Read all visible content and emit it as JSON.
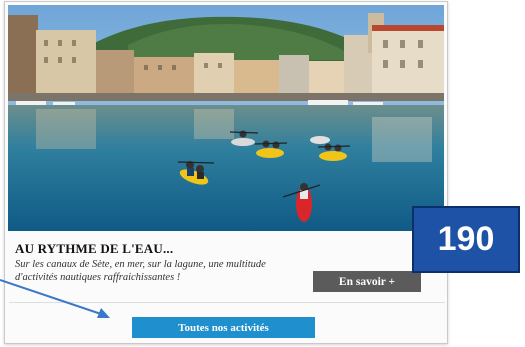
{
  "card": {
    "title": "AU RYTHME DE L'EAU...",
    "description": "Sur les canaux de Sète, en mer, sur la lagune, une multitude d'activités nautiques raffraichissantes !",
    "more_button_label": "En savoir +",
    "all_activities_button_label": "Toutes nos activités"
  },
  "badge": {
    "label": "190"
  },
  "colors": {
    "more_button": "#5b5b5b",
    "all_activities_button": "#1f8fcd",
    "badge": "#1d52a6",
    "arrow": "#3a78c9"
  }
}
